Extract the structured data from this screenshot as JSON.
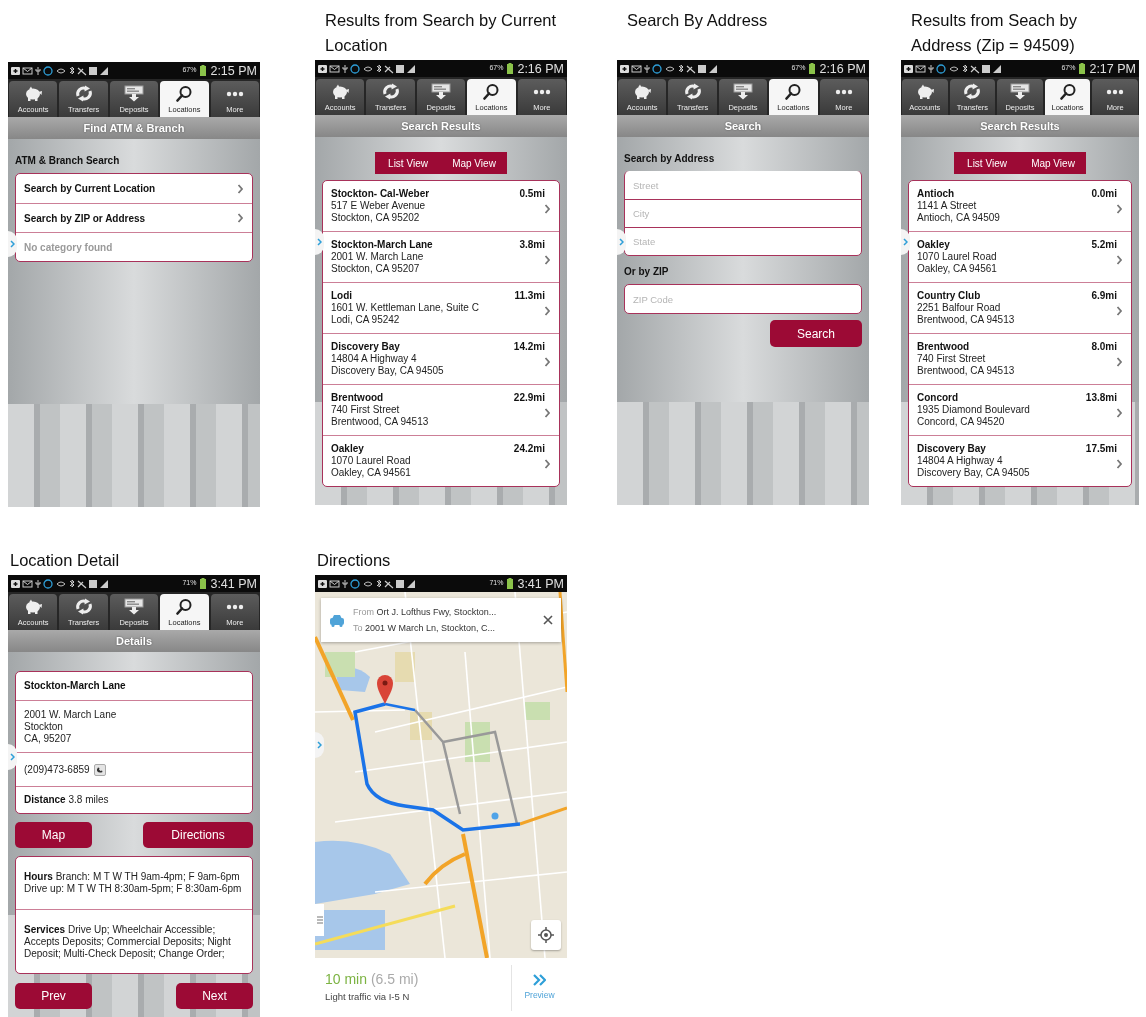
{
  "screens": [
    {
      "kind": "menu",
      "status": {
        "battery": "67%",
        "time": "2:15 PM"
      },
      "tabs": [
        {
          "label": "Accounts",
          "selected": false
        },
        {
          "label": "Transfers",
          "selected": false
        },
        {
          "label": "Deposits",
          "selected": false
        },
        {
          "label": "Locations",
          "selected": true
        },
        {
          "label": "More",
          "selected": false
        }
      ],
      "title": "Find ATM & Branch",
      "heading": "ATM & Branch Search",
      "items": [
        {
          "kind": "link",
          "label": "Search by Current Location"
        },
        {
          "kind": "link",
          "label": "Search by ZIP or Address"
        },
        {
          "kind": "empty",
          "label": "No category found"
        }
      ]
    },
    {
      "kind": "results",
      "caption": "Results from Search by Current Location",
      "status": {
        "battery": "67%",
        "time": "2:16 PM"
      },
      "tabs": [
        {
          "label": "Accounts",
          "selected": false
        },
        {
          "label": "Transfers",
          "selected": false
        },
        {
          "label": "Deposits",
          "selected": false
        },
        {
          "label": "Locations",
          "selected": true
        },
        {
          "label": "More",
          "selected": false
        }
      ],
      "title": "Search Results",
      "views": [
        "List View",
        "Map View"
      ],
      "results": [
        {
          "name": "Stockton- Cal-Weber",
          "distance": "0.5mi",
          "address": [
            "517 E Weber Avenue",
            "Stockton, CA 95202"
          ]
        },
        {
          "name": "Stockton-March Lane",
          "distance": "3.8mi",
          "address": [
            "2001 W. March Lane",
            "Stockton, CA 95207"
          ]
        },
        {
          "name": "Lodi",
          "distance": "11.3mi",
          "address": [
            "1601 W. Kettleman Lane, Suite C",
            "Lodi, CA 95242"
          ]
        },
        {
          "name": "Discovery Bay",
          "distance": "14.2mi",
          "address": [
            "14804 A Highway 4",
            "Discovery Bay, CA 94505"
          ]
        },
        {
          "name": "Brentwood",
          "distance": "22.9mi",
          "address": [
            "740 First Street",
            "Brentwood, CA 94513"
          ]
        },
        {
          "name": "Oakley",
          "distance": "24.2mi",
          "address": [
            "1070 Laurel Road",
            "Oakley, CA 94561"
          ]
        }
      ]
    },
    {
      "kind": "search_form",
      "caption": "Search By Address",
      "status": {
        "battery": "67%",
        "time": "2:16 PM"
      },
      "tabs": [
        {
          "label": "Accounts",
          "selected": false
        },
        {
          "label": "Transfers",
          "selected": false
        },
        {
          "label": "Deposits",
          "selected": false
        },
        {
          "label": "Locations",
          "selected": true
        },
        {
          "label": "More",
          "selected": false
        }
      ],
      "title": "Search",
      "heading": "Search by Address",
      "address_fields": [
        {
          "placeholder": "Street"
        },
        {
          "placeholder": "City"
        },
        {
          "placeholder": "State"
        }
      ],
      "zip_heading": "Or by ZIP",
      "zip_field": {
        "placeholder": "ZIP Code"
      },
      "button": "Search"
    },
    {
      "kind": "results",
      "caption": "Results from Seach by Address (Zip = 94509)",
      "status": {
        "battery": "67%",
        "time": "2:17 PM"
      },
      "tabs": [
        {
          "label": "Accounts",
          "selected": false
        },
        {
          "label": "Transfers",
          "selected": false
        },
        {
          "label": "Deposits",
          "selected": false
        },
        {
          "label": "Locations",
          "selected": true
        },
        {
          "label": "More",
          "selected": false
        }
      ],
      "title": "Search Results",
      "views": [
        "List View",
        "Map View"
      ],
      "results": [
        {
          "name": "Antioch",
          "distance": "0.0mi",
          "address": [
            "1141 A Street",
            "Antioch, CA 94509"
          ]
        },
        {
          "name": "Oakley",
          "distance": "5.2mi",
          "address": [
            "1070 Laurel Road",
            "Oakley, CA 94561"
          ]
        },
        {
          "name": "Country Club",
          "distance": "6.9mi",
          "address": [
            "2251 Balfour Road",
            "Brentwood, CA 94513"
          ]
        },
        {
          "name": "Brentwood",
          "distance": "8.0mi",
          "address": [
            "740 First Street",
            "Brentwood, CA 94513"
          ]
        },
        {
          "name": "Concord",
          "distance": "13.8mi",
          "address": [
            "1935 Diamond Boulevard",
            "Concord, CA 94520"
          ]
        },
        {
          "name": "Discovery Bay",
          "distance": "17.5mi",
          "address": [
            "14804 A Highway 4",
            "Discovery Bay, CA 94505"
          ]
        }
      ]
    },
    {
      "kind": "detail",
      "caption": "Location Detail",
      "status": {
        "battery": "71%",
        "time": "3:41 PM"
      },
      "tabs": [
        {
          "label": "Accounts",
          "selected": false
        },
        {
          "label": "Transfers",
          "selected": false
        },
        {
          "label": "Deposits",
          "selected": false
        },
        {
          "label": "Locations",
          "selected": true
        },
        {
          "label": "More",
          "selected": false
        }
      ],
      "title": "Details",
      "name": "Stockton-March Lane",
      "address": [
        "2001 W. March Lane",
        "Stockton",
        "CA, 95207"
      ],
      "phone": "(209)473-6859",
      "distance": {
        "label": "Distance",
        "value": "3.8 miles"
      },
      "buttons": [
        "Map",
        "Directions"
      ],
      "hours": {
        "label": "Hours",
        "value": "Branch: M T W TH 9am-4pm; F 9am-6pm Drive up: M T W TH 8:30am-5pm; F 8:30am-6pm"
      },
      "services": {
        "label": "Services",
        "value": "Drive Up; Wheelchair Accessible; Accepts Deposits; Commercial Deposits; Night Deposit; Multi-Check Deposit; Change Order;"
      },
      "nav_buttons": [
        "Prev",
        "Next"
      ]
    },
    {
      "kind": "map",
      "caption": "Directions",
      "status": {
        "battery": "71%",
        "time": "3:41 PM"
      },
      "route": {
        "from": {
          "label": "From",
          "value": "Ort J. Lofthus Fwy, Stockton..."
        },
        "to": {
          "label": "To",
          "value": "2001 W March Ln, Stockton, C..."
        }
      },
      "trip": {
        "duration": "10 min",
        "distance": "(6.5 mi)",
        "traffic": "Light traffic via I-5 N"
      },
      "preview": "Preview"
    }
  ]
}
